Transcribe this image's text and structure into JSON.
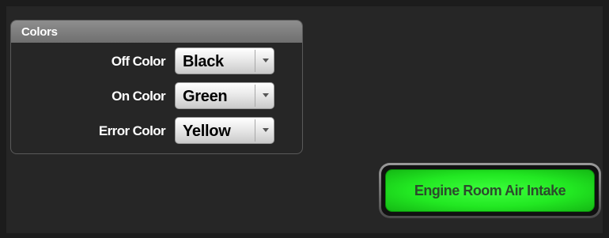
{
  "colors_panel": {
    "title": "Colors",
    "rows": [
      {
        "label": "Off Color",
        "value": "Black"
      },
      {
        "label": "On Color",
        "value": "Green"
      },
      {
        "label": "Error Color",
        "value": "Yellow"
      }
    ]
  },
  "indicator_button": {
    "label": "Engine Room Air Intake",
    "state_color": "#22e822"
  },
  "theme": {
    "background": "#262626",
    "panel_header": "#7f7f7f"
  }
}
